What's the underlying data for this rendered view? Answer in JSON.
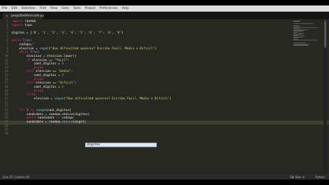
{
  "menu": [
    "File",
    "Edit",
    "Selection",
    "Find",
    "View",
    "Goto",
    "Tools",
    "Project",
    "Preferences",
    "Help"
  ],
  "tab": {
    "title": "JuegoDelAhorcado.py",
    "close": "×"
  },
  "line_numbers": [
    "1",
    "2",
    "3",
    "4",
    "5",
    "6",
    "7",
    "8",
    "9",
    "10",
    "11",
    "12",
    "13",
    "14",
    "15",
    "16",
    "17",
    "18",
    "19",
    "20",
    "21",
    "22",
    "23",
    "24",
    "25",
    "26",
    "27",
    "28",
    "29",
    "30"
  ],
  "code_lines": [
    [
      {
        "t": "import",
        "c": "kw"
      },
      {
        "t": " random",
        "c": ""
      }
    ],
    [
      {
        "t": "import",
        "c": "kw"
      },
      {
        "t": " time",
        "c": ""
      }
    ],
    [],
    [
      {
        "t": "digitos = [",
        "c": ""
      },
      {
        "t": "'0'",
        "c": "str"
      },
      {
        "t": ", ",
        "c": ""
      },
      {
        "t": "'1'",
        "c": "str"
      },
      {
        "t": ", ",
        "c": ""
      },
      {
        "t": "'2'",
        "c": "str"
      },
      {
        "t": ", ",
        "c": ""
      },
      {
        "t": "'3'",
        "c": "str"
      },
      {
        "t": ", ",
        "c": ""
      },
      {
        "t": "'4'",
        "c": "str"
      },
      {
        "t": ", ",
        "c": ""
      },
      {
        "t": "'5'",
        "c": "str"
      },
      {
        "t": ", ",
        "c": ""
      },
      {
        "t": "'6'",
        "c": "str"
      },
      {
        "t": ", ",
        "c": ""
      },
      {
        "t": "'7'",
        "c": "str"
      },
      {
        "t": ", ",
        "c": ""
      },
      {
        "t": "'8'",
        "c": "str"
      },
      {
        "t": ", ",
        "c": ""
      },
      {
        "t": "'9'",
        "c": "str"
      },
      {
        "t": "]",
        "c": ""
      }
    ],
    [],
    [
      {
        "t": "while",
        "c": "kw"
      },
      {
        "t": " ",
        "c": ""
      },
      {
        "t": "True",
        "c": "num"
      },
      {
        "t": ":",
        "c": ""
      }
    ],
    [
      {
        "t": "    codigo=",
        "c": ""
      },
      {
        "t": "''",
        "c": "str"
      }
    ],
    [
      {
        "t": "    eleccion = ",
        "c": ""
      },
      {
        "t": "input",
        "c": "fn"
      },
      {
        "t": "(",
        "c": ""
      },
      {
        "t": "\"Que dificultad quieres? Escribe Facil, Medio o Dificil\"",
        "c": "str"
      },
      {
        "t": ")",
        "c": ""
      }
    ],
    [
      {
        "t": "    ",
        "c": ""
      },
      {
        "t": "while",
        "c": "kw"
      },
      {
        "t": " ",
        "c": ""
      },
      {
        "t": "True",
        "c": "num"
      },
      {
        "t": ":",
        "c": ""
      }
    ],
    [
      {
        "t": "        eleccion = eleccion.lower()",
        "c": ""
      }
    ],
    [
      {
        "t": "        ",
        "c": ""
      },
      {
        "t": "if",
        "c": "kw"
      },
      {
        "t": " eleccion == ",
        "c": ""
      },
      {
        "t": "\"facil\"",
        "c": "str"
      },
      {
        "t": ":",
        "c": ""
      }
    ],
    [
      {
        "t": "            cant_digitos = ",
        "c": ""
      },
      {
        "t": "3",
        "c": "num"
      }
    ],
    [
      {
        "t": "            ",
        "c": ""
      },
      {
        "t": "break",
        "c": "kw"
      }
    ],
    [
      {
        "t": "        ",
        "c": ""
      },
      {
        "t": "elif",
        "c": "kw"
      },
      {
        "t": " eleccion == ",
        "c": ""
      },
      {
        "t": "\"medio\"",
        "c": "str"
      },
      {
        "t": ":",
        "c": ""
      }
    ],
    [
      {
        "t": "            cant_digitos = ",
        "c": ""
      },
      {
        "t": "4",
        "c": "num"
      }
    ],
    [
      {
        "t": "            ",
        "c": ""
      },
      {
        "t": "break",
        "c": "kw"
      }
    ],
    [
      {
        "t": "        ",
        "c": ""
      },
      {
        "t": "elif",
        "c": "kw"
      },
      {
        "t": " eleccion == ",
        "c": ""
      },
      {
        "t": "\"dificil\"",
        "c": "str"
      },
      {
        "t": ":",
        "c": ""
      }
    ],
    [
      {
        "t": "            cant_digitos = ",
        "c": ""
      },
      {
        "t": "5",
        "c": "num"
      }
    ],
    [
      {
        "t": "            ",
        "c": ""
      },
      {
        "t": "break",
        "c": "kw"
      }
    ],
    [
      {
        "t": "        ",
        "c": ""
      },
      {
        "t": "else",
        "c": "kw"
      },
      {
        "t": ":",
        "c": ""
      }
    ],
    [
      {
        "t": "            eleccion = ",
        "c": ""
      },
      {
        "t": "input",
        "c": "fn"
      },
      {
        "t": "(",
        "c": ""
      },
      {
        "t": "\"Que dificultad quieres? Escribe Facil, Medio o Dificil\"",
        "c": "str"
      },
      {
        "t": ")",
        "c": ""
      }
    ],
    [],
    [],
    [
      {
        "t": "    ",
        "c": ""
      },
      {
        "t": "for",
        "c": "kw"
      },
      {
        "t": " i ",
        "c": ""
      },
      {
        "t": "in",
        "c": "kw"
      },
      {
        "t": " ",
        "c": ""
      },
      {
        "t": "range",
        "c": "fn"
      },
      {
        "t": "(cant_digitos)",
        "c": ""
      }
    ],
    [
      {
        "t": "        candidato = random.choice(digitos)",
        "c": ""
      }
    ],
    [
      {
        "t": "        ",
        "c": ""
      },
      {
        "t": "while",
        "c": "kw"
      },
      {
        "t": " candidato ",
        "c": ""
      },
      {
        "t": "in",
        "c": "kw"
      },
      {
        "t": " codigo:",
        "c": ""
      }
    ],
    [
      {
        "t": "        candidato = random.",
        "c": ""
      },
      {
        "t": "choice",
        "c": "fn"
      },
      {
        "t": "(digit)",
        "c": ""
      }
    ],
    [],
    [],
    []
  ],
  "autocomplete": {
    "item": "digitos"
  },
  "status": {
    "left": "Line 27, Column 44",
    "tab_size": "Tab Size: 4",
    "syntax": "Python"
  },
  "colors": {
    "keyword": "#f92672",
    "string": "#e6db74",
    "number": "#ae81ff",
    "function": "#66d9ef",
    "background": "#272822"
  }
}
